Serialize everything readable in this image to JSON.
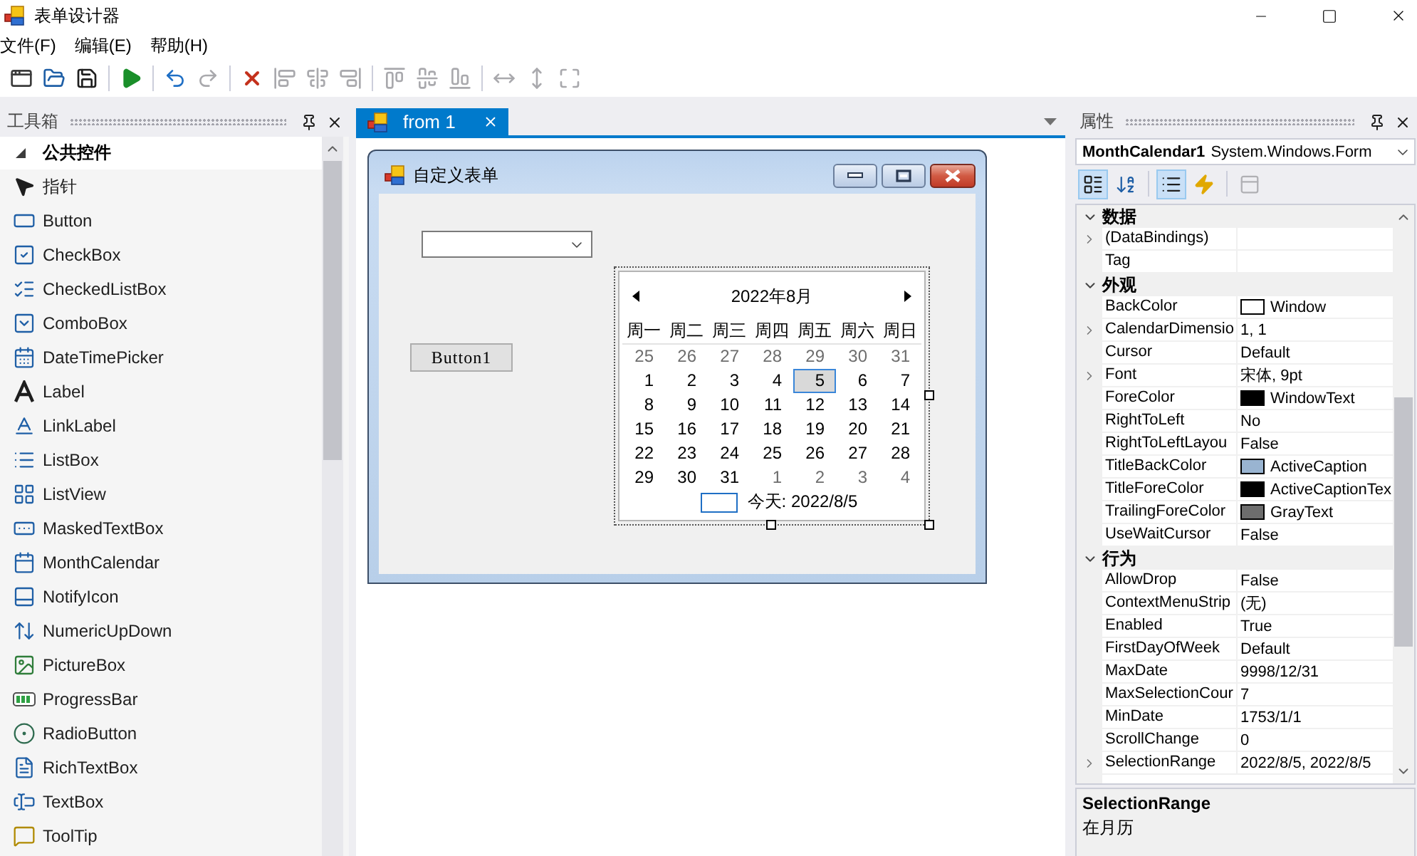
{
  "window": {
    "title": "表单设计器"
  },
  "menu": [
    {
      "label": "文件(F)"
    },
    {
      "label": "编辑(E)"
    },
    {
      "label": "帮助(H)"
    }
  ],
  "toolbar": [
    [
      {
        "kind": "new-form",
        "disabled": false
      },
      {
        "kind": "open",
        "disabled": false
      },
      {
        "kind": "save",
        "disabled": false
      }
    ],
    [
      {
        "kind": "run",
        "disabled": false
      }
    ],
    [
      {
        "kind": "undo",
        "disabled": false
      },
      {
        "kind": "redo",
        "disabled": true
      }
    ],
    [
      {
        "kind": "delete",
        "disabled": false
      },
      {
        "kind": "align-left",
        "disabled": true
      },
      {
        "kind": "align-center",
        "disabled": true
      },
      {
        "kind": "align-right",
        "disabled": true
      }
    ],
    [
      {
        "kind": "align-top",
        "disabled": true
      },
      {
        "kind": "align-middle",
        "disabled": true
      },
      {
        "kind": "align-bottom",
        "disabled": true
      }
    ],
    [
      {
        "kind": "same-width",
        "disabled": true
      },
      {
        "kind": "same-height",
        "disabled": true
      },
      {
        "kind": "fit",
        "disabled": true
      }
    ]
  ],
  "toolbox": {
    "title": "工具箱",
    "groups": [
      {
        "label": "公共控件",
        "expanded": true,
        "items": [
          {
            "label": "指针",
            "kind": "pointer"
          },
          {
            "label": "Button",
            "kind": "button"
          },
          {
            "label": "CheckBox",
            "kind": "checkbox"
          },
          {
            "label": "CheckedListBox",
            "kind": "checked-list-box"
          },
          {
            "label": "ComboBox",
            "kind": "combo-box"
          },
          {
            "label": "DateTimePicker",
            "kind": "date-time-picker"
          },
          {
            "label": "Label",
            "kind": "label"
          },
          {
            "label": "LinkLabel",
            "kind": "link-label"
          },
          {
            "label": "ListBox",
            "kind": "list-box"
          },
          {
            "label": "ListView",
            "kind": "list-view"
          },
          {
            "label": "MaskedTextBox",
            "kind": "masked-text-box"
          },
          {
            "label": "MonthCalendar",
            "kind": "month-calendar"
          },
          {
            "label": "NotifyIcon",
            "kind": "notify-icon"
          },
          {
            "label": "NumericUpDown",
            "kind": "numeric-up-down"
          },
          {
            "label": "PictureBox",
            "kind": "picture-box"
          },
          {
            "label": "ProgressBar",
            "kind": "progress-bar"
          },
          {
            "label": "RadioButton",
            "kind": "radio-button"
          },
          {
            "label": "RichTextBox",
            "kind": "rich-text-box"
          },
          {
            "label": "TextBox",
            "kind": "text-box"
          },
          {
            "label": "ToolTip",
            "kind": "tooltip"
          }
        ]
      }
    ]
  },
  "document_tabs": [
    {
      "label": "from 1",
      "selected": true
    }
  ],
  "form": {
    "title": "自定义表单",
    "button": {
      "label": "Button1"
    },
    "calendar": {
      "selected": true,
      "month": "2022年8月",
      "weekdays": [
        "周一",
        "周二",
        "周三",
        "周四",
        "周五",
        "周六",
        "周日"
      ],
      "days": [
        {
          "label": "25",
          "trailing": true,
          "selected": false
        },
        {
          "label": "26",
          "trailing": true,
          "selected": false
        },
        {
          "label": "27",
          "trailing": true,
          "selected": false
        },
        {
          "label": "28",
          "trailing": true,
          "selected": false
        },
        {
          "label": "29",
          "trailing": true,
          "selected": false
        },
        {
          "label": "30",
          "trailing": true,
          "selected": false
        },
        {
          "label": "31",
          "trailing": true,
          "selected": false
        },
        {
          "label": "1",
          "trailing": false,
          "selected": false
        },
        {
          "label": "2",
          "trailing": false,
          "selected": false
        },
        {
          "label": "3",
          "trailing": false,
          "selected": false
        },
        {
          "label": "4",
          "trailing": false,
          "selected": false
        },
        {
          "label": "5",
          "trailing": false,
          "selected": true
        },
        {
          "label": "6",
          "trailing": false,
          "selected": false
        },
        {
          "label": "7",
          "trailing": false,
          "selected": false
        },
        {
          "label": "8",
          "trailing": false,
          "selected": false
        },
        {
          "label": "9",
          "trailing": false,
          "selected": false
        },
        {
          "label": "10",
          "trailing": false,
          "selected": false
        },
        {
          "label": "11",
          "trailing": false,
          "selected": false
        },
        {
          "label": "12",
          "trailing": false,
          "selected": false
        },
        {
          "label": "13",
          "trailing": false,
          "selected": false
        },
        {
          "label": "14",
          "trailing": false,
          "selected": false
        },
        {
          "label": "15",
          "trailing": false,
          "selected": false
        },
        {
          "label": "16",
          "trailing": false,
          "selected": false
        },
        {
          "label": "17",
          "trailing": false,
          "selected": false
        },
        {
          "label": "18",
          "trailing": false,
          "selected": false
        },
        {
          "label": "19",
          "trailing": false,
          "selected": false
        },
        {
          "label": "20",
          "trailing": false,
          "selected": false
        },
        {
          "label": "21",
          "trailing": false,
          "selected": false
        },
        {
          "label": "22",
          "trailing": false,
          "selected": false
        },
        {
          "label": "23",
          "trailing": false,
          "selected": false
        },
        {
          "label": "24",
          "trailing": false,
          "selected": false
        },
        {
          "label": "25",
          "trailing": false,
          "selected": false
        },
        {
          "label": "26",
          "trailing": false,
          "selected": false
        },
        {
          "label": "27",
          "trailing": false,
          "selected": false
        },
        {
          "label": "28",
          "trailing": false,
          "selected": false
        },
        {
          "label": "29",
          "trailing": false,
          "selected": false
        },
        {
          "label": "30",
          "trailing": false,
          "selected": false
        },
        {
          "label": "31",
          "trailing": false,
          "selected": false
        },
        {
          "label": "1",
          "trailing": true,
          "selected": false
        },
        {
          "label": "2",
          "trailing": true,
          "selected": false
        },
        {
          "label": "3",
          "trailing": true,
          "selected": false
        },
        {
          "label": "4",
          "trailing": true,
          "selected": false
        }
      ],
      "today": "今天: 2022/8/5"
    }
  },
  "properties": {
    "title": "属性",
    "object": {
      "name": "MonthCalendar1",
      "type": "System.Windows.Form"
    },
    "tools": [
      [
        {
          "kind": "categorized",
          "selected": true,
          "disabled": false
        },
        {
          "kind": "alphabetical",
          "selected": false,
          "disabled": false
        }
      ],
      [
        {
          "kind": "properties",
          "selected": true,
          "disabled": false
        },
        {
          "kind": "events",
          "selected": false,
          "disabled": false
        }
      ],
      [
        {
          "kind": "property-pages",
          "selected": false,
          "disabled": true
        }
      ]
    ],
    "categories": [
      {
        "label": "数据",
        "expanded": true,
        "rows": [
          {
            "name": "(DataBindings)",
            "expandable": true
          },
          {
            "name": "Tag",
            "expandable": false
          }
        ]
      },
      {
        "label": "外观",
        "expanded": true,
        "rows": [
          {
            "name": "BackColor",
            "expandable": false,
            "color": "#ffffff",
            "value": "Window"
          },
          {
            "name": "CalendarDimensio",
            "expandable": true,
            "value": "1, 1"
          },
          {
            "name": "Cursor",
            "expandable": false,
            "value": "Default"
          },
          {
            "name": "Font",
            "expandable": true,
            "value": "宋体, 9pt"
          },
          {
            "name": "ForeColor",
            "expandable": false,
            "color": "#000000",
            "value": "WindowText"
          },
          {
            "name": "RightToLeft",
            "expandable": false,
            "value": "No"
          },
          {
            "name": "RightToLeftLayou",
            "expandable": false,
            "value": "False"
          },
          {
            "name": "TitleBackColor",
            "expandable": false,
            "color": "#99b4d1",
            "value": "ActiveCaption"
          },
          {
            "name": "TitleForeColor",
            "expandable": false,
            "color": "#000000",
            "value": "ActiveCaptionTex"
          },
          {
            "name": "TrailingForeColor",
            "expandable": false,
            "color": "#6d6d6d",
            "value": "GrayText"
          },
          {
            "name": "UseWaitCursor",
            "expandable": false,
            "value": "False"
          }
        ]
      },
      {
        "label": "行为",
        "expanded": true,
        "rows": [
          {
            "name": "AllowDrop",
            "expandable": false,
            "value": "False"
          },
          {
            "name": "ContextMenuStrip",
            "expandable": false,
            "value": "(无)"
          },
          {
            "name": "Enabled",
            "expandable": false,
            "value": "True"
          },
          {
            "name": "FirstDayOfWeek",
            "expandable": false,
            "value": "Default"
          },
          {
            "name": "MaxDate",
            "expandable": false,
            "value": "9998/12/31"
          },
          {
            "name": "MaxSelectionCour",
            "expandable": false,
            "value": "7"
          },
          {
            "name": "MinDate",
            "expandable": false,
            "value": "1753/1/1"
          },
          {
            "name": "ScrollChange",
            "expandable": false,
            "value": "0"
          },
          {
            "name": "SelectionRange",
            "expandable": true,
            "value": "2022/8/5, 2022/8/5"
          }
        ]
      }
    ],
    "description": {
      "title": "SelectionRange",
      "text": "在月历"
    }
  }
}
